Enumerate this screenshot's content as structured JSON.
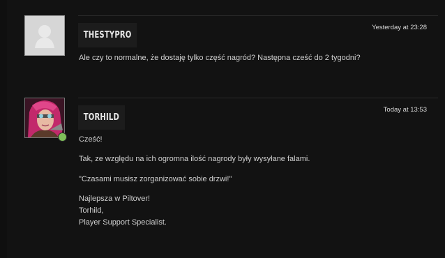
{
  "posts": [
    {
      "author": "THESTYPRO",
      "time": "Yesterday at 23:28",
      "avatar": "default-avatar-icon",
      "paragraphs": [
        "Ale czy to normalne, że dostaję tylko część nagród? Następna cześć do 2 tygodni?"
      ]
    },
    {
      "author": "TORHILD",
      "time": "Today at 13:53",
      "avatar": "character-portrait",
      "online": true,
      "paragraphs": [
        "Cześć!",
        "Tak, ze względu na ich ogromna ilość nagrody były wysyłane falami.",
        "\"Czasami musisz zorganizować sobie drzwi!\"",
        "Najlepsza w Piltover!",
        "Torhild,",
        "Player Support Specialist."
      ]
    }
  ],
  "colors": {
    "background": "#121212",
    "name_box": "#1c1c1c",
    "online": "#7fbf5a"
  }
}
